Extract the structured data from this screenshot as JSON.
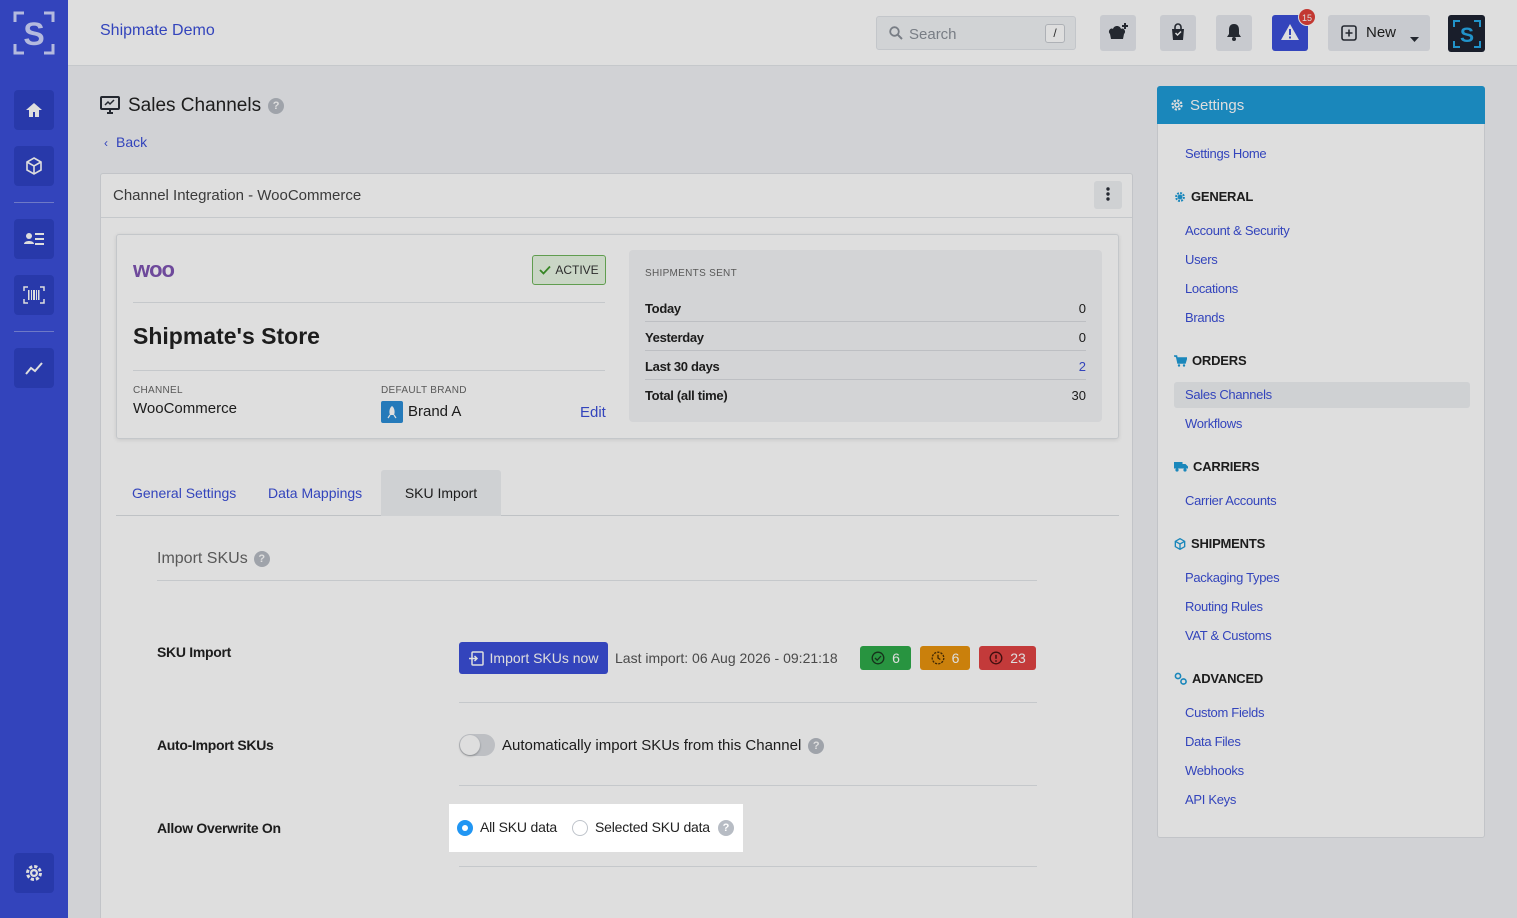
{
  "app": {
    "name": "Shipmate Demo",
    "logo_letter": "S"
  },
  "search": {
    "placeholder": "Search",
    "shortcut": "/"
  },
  "topbar": {
    "alerts_count": "15",
    "new_label": "New",
    "icons": [
      "chef-hat-plus-icon",
      "shopping-bag-icon",
      "bell-icon",
      "warning-icon",
      "plus-square-icon",
      "caret-down-icon"
    ]
  },
  "rail": {
    "icons": [
      "home-icon",
      "package-icon",
      "contact-list-icon",
      "barcode-icon",
      "trend-chart-icon",
      "gear-icon"
    ]
  },
  "page": {
    "title": "Sales Channels",
    "back_label": "Back"
  },
  "card": {
    "title": "Channel Integration - WooCommerce",
    "status": "ACTIVE",
    "store_name": "Shipmate's Store",
    "channel_label": "CHANNEL",
    "channel_value": "WooCommerce",
    "default_brand_label": "DEFAULT BRAND",
    "default_brand_value": "Brand A",
    "edit_label": "Edit",
    "logo_text": "woo"
  },
  "shipments": {
    "heading": "SHIPMENTS SENT",
    "rows": [
      {
        "label": "Today",
        "value": "0"
      },
      {
        "label": "Yesterday",
        "value": "0"
      },
      {
        "label": "Last 30 days",
        "value": "2"
      },
      {
        "label": "Total (all time)",
        "value": "30"
      }
    ]
  },
  "tabs": [
    {
      "label": "General Settings",
      "active": false
    },
    {
      "label": "Data Mappings",
      "active": false
    },
    {
      "label": "SKU Import",
      "active": true
    }
  ],
  "sku": {
    "section_title": "Import SKUs",
    "import_label": "SKU Import",
    "import_button": "Import SKUs now",
    "last_import": "Last import: 06 Aug 2026 - 09:21:18",
    "counts": {
      "success": "6",
      "pending": "6",
      "error": "23"
    },
    "auto_label": "Auto-Import SKUs",
    "auto_text": "Automatically import SKUs from this Channel",
    "auto_enabled": false,
    "overwrite_label": "Allow Overwrite On",
    "overwrite_options": [
      "All SKU data",
      "Selected SKU data"
    ],
    "overwrite_selected": "All SKU data"
  },
  "settings": {
    "title": "Settings",
    "home": "Settings Home",
    "groups": [
      {
        "title": "GENERAL",
        "icon": "gear-icon",
        "items": [
          "Account & Security",
          "Users",
          "Locations",
          "Brands"
        ]
      },
      {
        "title": "ORDERS",
        "icon": "cart-icon",
        "items": [
          "Sales Channels",
          "Workflows"
        ]
      },
      {
        "title": "CARRIERS",
        "icon": "truck-icon",
        "items": [
          "Carrier Accounts"
        ]
      },
      {
        "title": "SHIPMENTS",
        "icon": "box-icon",
        "items": [
          "Packaging Types",
          "Routing Rules",
          "VAT & Customs"
        ]
      },
      {
        "title": "ADVANCED",
        "icon": "gears-icon",
        "items": [
          "Custom Fields",
          "Data Files",
          "Webhooks",
          "API Keys"
        ]
      }
    ],
    "active_item": "Sales Channels"
  },
  "colors": {
    "primary": "#3b4fd8",
    "settings_header": "#1e9bd7",
    "success": "#2eab4a",
    "pending": "#e8930e",
    "error": "#e04343"
  }
}
